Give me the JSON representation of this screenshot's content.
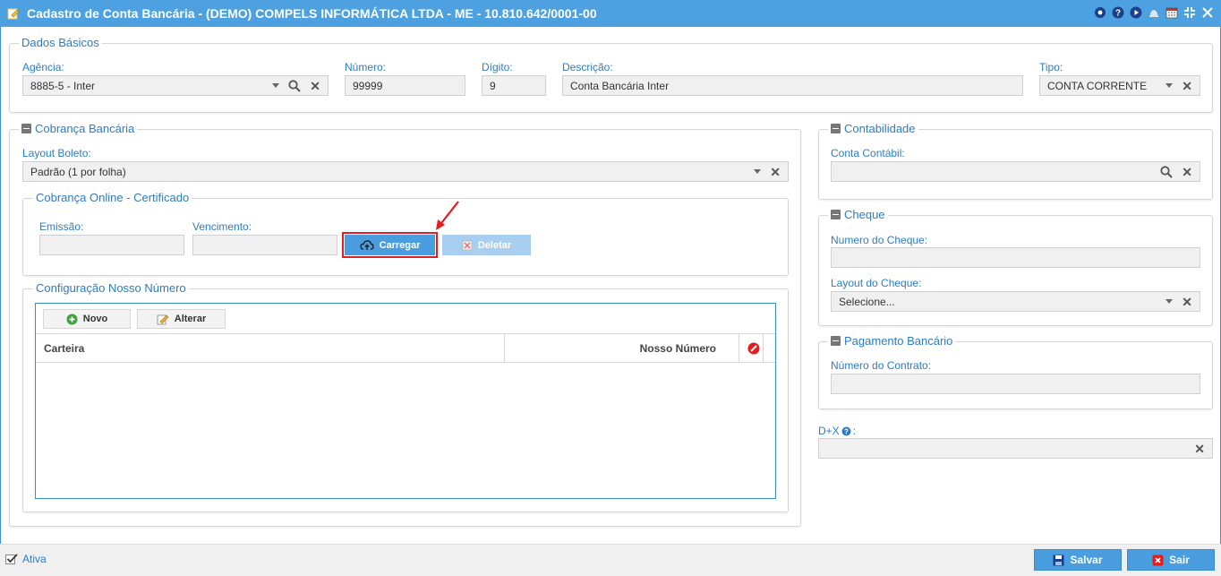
{
  "title": "Cadastro de Conta Bancária - (DEMO) COMPELS INFORMÁTICA LTDA - ME - 10.810.642/0001-00",
  "dados_basicos": {
    "legend": "Dados Básicos",
    "agencia": {
      "label": "Agência:",
      "value": "8885-5 - Inter"
    },
    "numero": {
      "label": "Número:",
      "value": "99999"
    },
    "digito": {
      "label": "Dígito:",
      "value": "9"
    },
    "descricao": {
      "label": "Descrição:",
      "value": "Conta Bancária Inter"
    },
    "tipo": {
      "label": "Tipo:",
      "value": "CONTA CORRENTE"
    }
  },
  "cobranca": {
    "legend": "Cobrança Bancária",
    "layout_boleto": {
      "label": "Layout Boleto:",
      "value": "Padrão (1 por folha)"
    },
    "online": {
      "legend": "Cobrança Online - Certificado",
      "emissao_label": "Emissão:",
      "vencimento_label": "Vencimento:",
      "carregar_label": "Carregar",
      "deletar_label": "Deletar"
    },
    "nosso_numero": {
      "legend": "Configuração Nosso Número",
      "novo_label": "Novo",
      "alterar_label": "Alterar",
      "columns": [
        "Carteira",
        "Nosso Número"
      ]
    }
  },
  "contabilidade": {
    "legend": "Contabilidade",
    "conta_label": "Conta Contábil:"
  },
  "cheque": {
    "legend": "Cheque",
    "numero_label": "Numero do Cheque:",
    "layout_label": "Layout do Cheque:",
    "layout_placeholder": "Selecione..."
  },
  "pagamento": {
    "legend": "Pagamento Bancário",
    "contrato_label": "Número do Contrato:"
  },
  "dx": {
    "label": "D+X",
    "suffix": ":"
  },
  "footer": {
    "ativa_label": "Ativa",
    "salvar_label": "Salvar",
    "sair_label": "Sair"
  },
  "colors": {
    "header": "#4da1e0",
    "accent": "#2c7cc4",
    "button": "#4a9ee0",
    "highlight": "#e02020"
  }
}
